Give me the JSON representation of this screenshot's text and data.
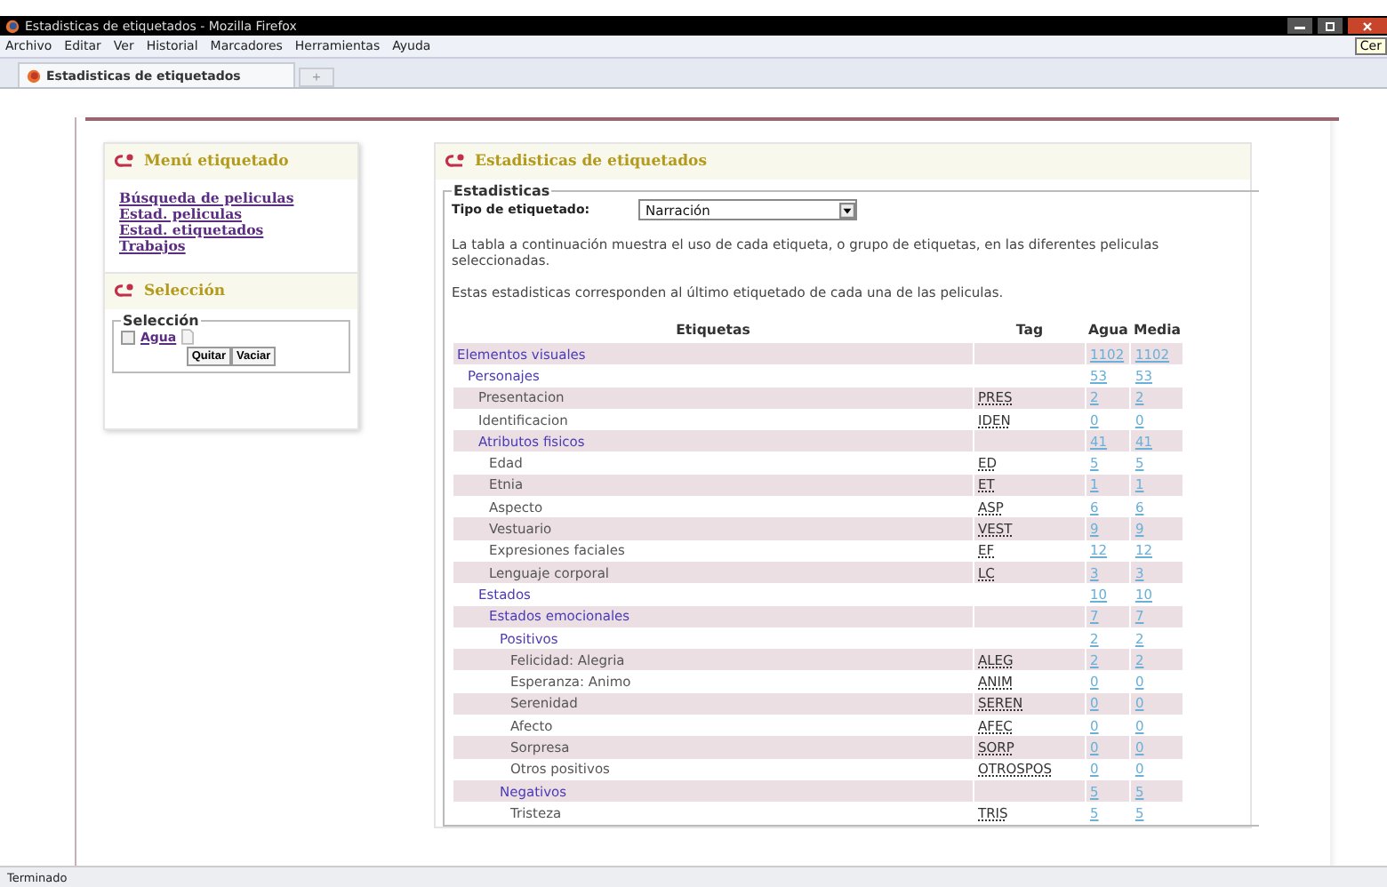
{
  "window": {
    "title": "Estadisticas de etiquetados - Mozilla Firefox",
    "tooltip": "Cer"
  },
  "menu": [
    {
      "label": "Archivo"
    },
    {
      "label": "Editar"
    },
    {
      "label": "Ver"
    },
    {
      "label": "Historial"
    },
    {
      "label": "Marcadores"
    },
    {
      "label": "Herramientas"
    },
    {
      "label": "Ayuda"
    }
  ],
  "tabs": [
    {
      "label": "Estadisticas de etiquetados",
      "selected": true
    }
  ],
  "new_tab": "+",
  "sidebar": {
    "menu_title": "Menú etiquetado",
    "links": [
      "Búsqueda de peliculas",
      "Estad. peliculas",
      "Estad. etiquetados",
      "Trabajos"
    ],
    "selection_title": "Selección",
    "selection_legend": "Selección",
    "items": [
      {
        "label": "Agua",
        "checked": false
      }
    ],
    "buttons": [
      "Quitar",
      "Vaciar"
    ]
  },
  "main": {
    "title": "Estadisticas de etiquetados",
    "legend": "Estadisticas",
    "type_label": "Tipo de etiquetado:",
    "type_value": "Narración",
    "paragraphs": [
      "La tabla a continuación muestra el uso de cada etiqueta, o grupo de etiquetas, en las diferentes peliculas seleccionadas.",
      "Estas estadisticas corresponden al último etiquetado de cada una de las peliculas."
    ]
  },
  "table": {
    "columns": [
      "Etiquetas",
      "Tag",
      "Agua",
      "Media"
    ],
    "rows": [
      {
        "kind": "group",
        "label": "Elementos visuales",
        "agua": "1102",
        "media": "1102",
        "children": [
          {
            "kind": "group",
            "label": "Personajes",
            "agua": "53",
            "media": "53",
            "children": [
              {
                "kind": "leaf",
                "label": "Presentacion",
                "tag": "PRES",
                "agua": "2",
                "media": "2"
              },
              {
                "kind": "leaf",
                "label": "Identificacion",
                "tag": "IDEN",
                "agua": "0",
                "media": "0"
              },
              {
                "kind": "group",
                "label": "Atributos fisicos",
                "agua": "41",
                "media": "41",
                "children": [
                  {
                    "kind": "leaf",
                    "label": "Edad",
                    "tag": "ED",
                    "agua": "5",
                    "media": "5"
                  },
                  {
                    "kind": "leaf",
                    "label": "Etnia",
                    "tag": "ET",
                    "agua": "1",
                    "media": "1"
                  },
                  {
                    "kind": "leaf",
                    "label": "Aspecto",
                    "tag": "ASP",
                    "agua": "6",
                    "media": "6"
                  },
                  {
                    "kind": "leaf",
                    "label": "Vestuario",
                    "tag": "VEST",
                    "agua": "9",
                    "media": "9"
                  },
                  {
                    "kind": "leaf",
                    "label": "Expresiones faciales",
                    "tag": "EF",
                    "agua": "12",
                    "media": "12"
                  },
                  {
                    "kind": "leaf",
                    "label": "Lenguaje corporal",
                    "tag": "LC",
                    "agua": "3",
                    "media": "3"
                  }
                ]
              },
              {
                "kind": "group",
                "label": "Estados",
                "agua": "10",
                "media": "10",
                "children": [
                  {
                    "kind": "group",
                    "label": "Estados emocionales",
                    "agua": "7",
                    "media": "7",
                    "children": [
                      {
                        "kind": "group",
                        "label": "Positivos",
                        "agua": "2",
                        "media": "2",
                        "children": [
                          {
                            "kind": "leaf",
                            "label": "Felicidad: Alegria",
                            "tag": "ALEG",
                            "agua": "2",
                            "media": "2"
                          },
                          {
                            "kind": "leaf",
                            "label": "Esperanza: Animo",
                            "tag": "ANIM",
                            "agua": "0",
                            "media": "0"
                          },
                          {
                            "kind": "leaf",
                            "label": "Serenidad",
                            "tag": "SEREN",
                            "agua": "0",
                            "media": "0"
                          },
                          {
                            "kind": "leaf",
                            "label": "Afecto",
                            "tag": "AFEC",
                            "agua": "0",
                            "media": "0"
                          },
                          {
                            "kind": "leaf",
                            "label": "Sorpresa",
                            "tag": "SORP",
                            "agua": "0",
                            "media": "0"
                          },
                          {
                            "kind": "leaf",
                            "label": "Otros positivos",
                            "tag": "OTROSPOS",
                            "agua": "0",
                            "media": "0"
                          }
                        ]
                      },
                      {
                        "kind": "group",
                        "label": "Negativos",
                        "agua": "5",
                        "media": "5",
                        "children": [
                          {
                            "kind": "leaf",
                            "label": "Tristeza",
                            "tag": "TRIS",
                            "agua": "5",
                            "media": "5"
                          }
                        ]
                      }
                    ]
                  }
                ]
              }
            ]
          }
        ]
      }
    ]
  },
  "status_bar": "Terminado"
}
